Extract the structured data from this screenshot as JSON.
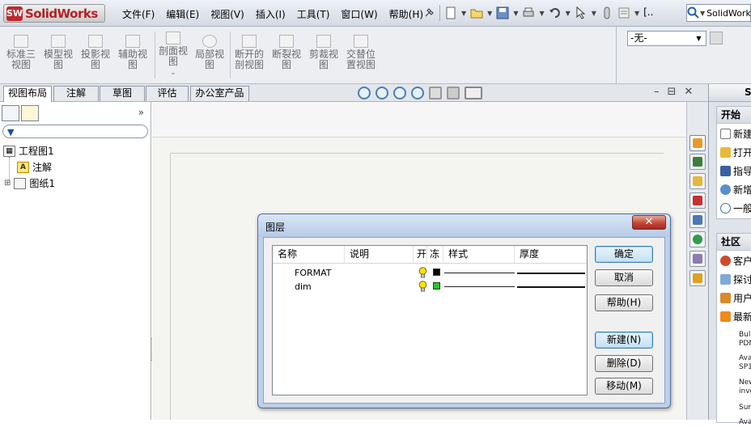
{
  "app": {
    "logo_text": "SolidWorks",
    "logo_mark": "SW"
  },
  "menu": [
    "文件(F)",
    "编辑(E)",
    "视图(V)",
    "插入(I)",
    "工具(T)",
    "窗口(W)",
    "帮助(H)"
  ],
  "search": {
    "value": "SolidWorks"
  },
  "command_manager": {
    "items": [
      {
        "label_line1": "标准三",
        "label_line2": "视图"
      },
      {
        "label_line1": "模型视",
        "label_line2": "图"
      },
      {
        "label_line1": "投影视",
        "label_line2": "图"
      },
      {
        "label_line1": "辅助视",
        "label_line2": "图"
      },
      {
        "label_line1": "剖面视",
        "label_line2": "图"
      },
      {
        "label_line1": "局部视",
        "label_line2": "图"
      },
      {
        "label_line1": "断开的",
        "label_line2": "剖视图"
      },
      {
        "label_line1": "断裂视",
        "label_line2": "图"
      },
      {
        "label_line1": "剪裁视",
        "label_line2": "图"
      },
      {
        "label_line1": "交替位",
        "label_line2": "置视图"
      }
    ],
    "layer_select": "-无-"
  },
  "tabs": [
    "视图布局",
    "注解",
    "草图",
    "评估",
    "办公室产品"
  ],
  "active_tab": "视图布局",
  "window_controls": {
    "minimize": "–",
    "restore": "⊟",
    "close": "✕"
  },
  "tree": {
    "more": "»",
    "root": "工程图1",
    "children": [
      "注解",
      "图纸1"
    ],
    "expand": "⊞"
  },
  "task_pane": {
    "header": "Sol",
    "section1": {
      "title": "开始",
      "items": [
        "新建",
        "打开",
        "指导",
        "新增",
        "一般"
      ]
    },
    "section2": {
      "title": "社区",
      "items": [
        "客户",
        "探讨",
        "用户",
        "最新"
      ]
    },
    "news": [
      [
        "Bull",
        "PDM"
      ],
      [
        "Ava",
        "SP1"
      ],
      [
        "New",
        "inve"
      ],
      [
        "Sur"
      ],
      [
        "Ava"
      ]
    ]
  },
  "dialog": {
    "title": "图层",
    "close_label": "✕",
    "columns": [
      "名称",
      "说明",
      "开",
      "冻",
      "样式",
      "厚度"
    ],
    "rows": [
      {
        "name": "FORMAT",
        "color": "#000000"
      },
      {
        "name": "dim",
        "color": "#22cc22"
      }
    ],
    "buttons": {
      "ok": "确定",
      "cancel": "取消",
      "help": "帮助(H)",
      "new": "新建(N)",
      "delete": "删除(D)",
      "move": "移动(M)"
    }
  },
  "colors": {
    "brand_red": "#b42026",
    "dialog_frame": "#bcd0ea",
    "accent_blue": "#3c7fb1"
  }
}
